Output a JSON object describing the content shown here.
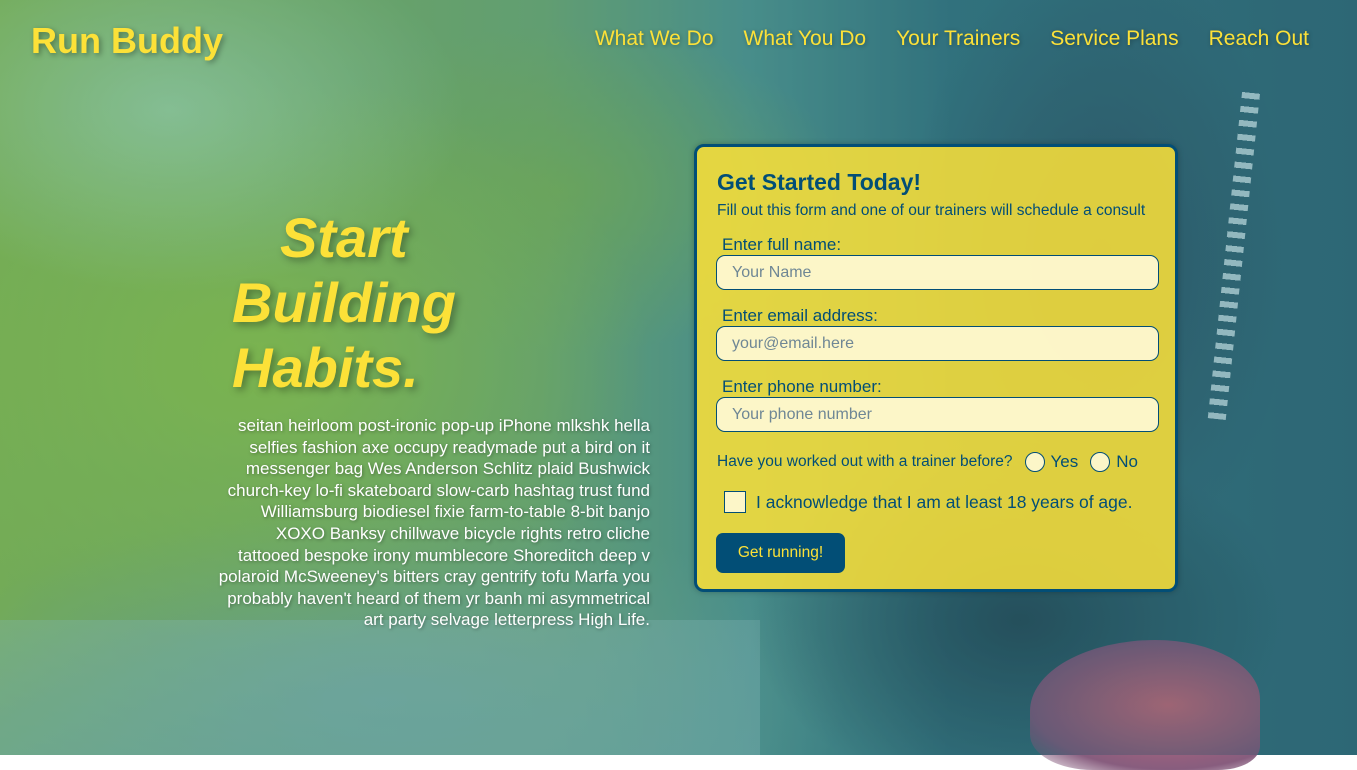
{
  "header": {
    "logo": "Run Buddy",
    "nav": [
      "What We Do",
      "What You Do",
      "Your Trainers",
      "Service Plans",
      "Reach Out"
    ]
  },
  "hero": {
    "heading_lines": [
      "Start",
      "Building",
      "Habits."
    ],
    "body": "seitan heirloom post-ironic pop-up iPhone mlkshk hella selfies fashion axe occupy readymade put a bird on it messenger bag Wes Anderson Schlitz plaid Bushwick church-key lo-fi skateboard slow-carb hashtag trust fund Williamsburg biodiesel fixie farm-to-table 8-bit banjo XOXO Banksy chillwave bicycle rights retro cliche tattooed bespoke irony mumblecore Shoreditch deep v polaroid McSweeney's bitters cray gentrify tofu Marfa you probably haven't heard of them yr banh mi asymmetrical art party selvage letterpress High Life."
  },
  "form": {
    "title": "Get Started Today!",
    "subtitle": "Fill out this form and one of our trainers will schedule a consult",
    "fields": [
      {
        "label": "Enter full name:",
        "placeholder": "Your Name"
      },
      {
        "label": "Enter email address:",
        "placeholder": "your@email.here"
      },
      {
        "label": "Enter phone number:",
        "placeholder": "Your phone number"
      }
    ],
    "question": "Have you worked out with a trainer before?",
    "options": [
      "Yes",
      "No"
    ],
    "acknowledge": "I acknowledge that I am at least 18 years of age.",
    "submit": "Get running!"
  },
  "colors": {
    "accent": "#fce138",
    "primary": "#024e76"
  }
}
